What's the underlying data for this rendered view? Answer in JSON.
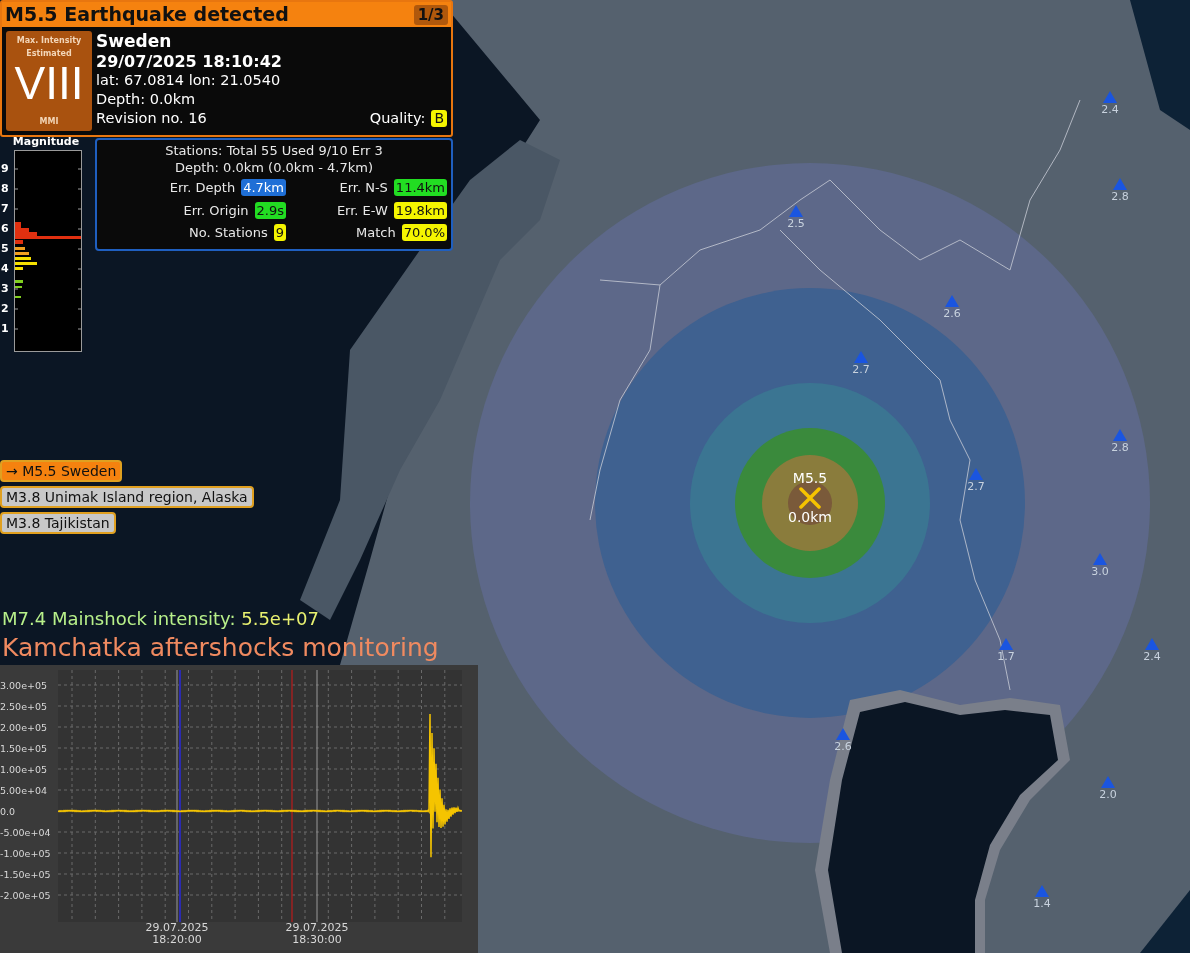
{
  "alert": {
    "title": "M5.5 Earthquake detected",
    "counter": "1/3",
    "intensity": {
      "caption": "Max. Intensity Estimated",
      "value": "VIII",
      "scale": "MMI"
    },
    "region": "Sweden",
    "time": "29/07/2025 18:10:42",
    "coordinates": "lat: 67.0814 lon: 21.0540",
    "depth": "Depth: 0.0km",
    "revision": "Revision no. 16",
    "quality_label": "Quality:",
    "quality": "B"
  },
  "magnitude_chart": {
    "title": "Magnitude",
    "ticks": [
      "9",
      "8",
      "7",
      "6",
      "5",
      "4",
      "3",
      "2",
      "1"
    ]
  },
  "stations_panel": {
    "summary": "Stations: Total 55 Used 9/10 Err 3",
    "depth_range": "Depth: 0.0km (0.0km - 4.7km)",
    "stats": [
      {
        "label": "Err. Depth",
        "value": "4.7km",
        "color": "#1f6fd6"
      },
      {
        "label": "Err. N-S",
        "value": "11.4km",
        "color": "#22dd22"
      },
      {
        "label": "Err. Origin",
        "value": "2.9s",
        "color": "#22dd22"
      },
      {
        "label": "Err. E-W",
        "value": "19.8km",
        "color": "#f5f500"
      },
      {
        "label": "No. Stations",
        "value": "9",
        "color": "#f5f500"
      },
      {
        "label": "Match",
        "value": "70.0%",
        "color": "#f5f500"
      }
    ]
  },
  "events": [
    {
      "label": "→ M5.5 Sweden",
      "selected": true
    },
    {
      "label": "M3.8 Unimak Island region, Alaska",
      "selected": false
    },
    {
      "label": "M3.8 Tajikistan",
      "selected": false
    }
  ],
  "mainshock": {
    "label": "M7.4 Mainshock intensity:",
    "value": "5.5e+07"
  },
  "monitoring_title": "Kamchatka aftershocks monitoring",
  "seismogram": {
    "y_ticks": [
      "3.00e+05",
      "2.50e+05",
      "2.00e+05",
      "1.50e+05",
      "1.00e+05",
      "5.00e+04",
      "0.0",
      "-5.00e+04",
      "-1.00e+05",
      "-1.50e+05",
      "-2.00e+05"
    ],
    "x_ticks": [
      {
        "date": "29.07.2025",
        "time": "18:20:00"
      },
      {
        "date": "29.07.2025",
        "time": "18:30:00"
      }
    ]
  },
  "map": {
    "epicenter": {
      "magnitude": "M5.5",
      "depth": "0.0km"
    },
    "stations": [
      {
        "reading": "2.4"
      },
      {
        "reading": "2.8"
      },
      {
        "reading": "2.5"
      },
      {
        "reading": "2.6"
      },
      {
        "reading": "2.7"
      },
      {
        "reading": "2.8"
      },
      {
        "reading": "2.7"
      },
      {
        "reading": "3.0"
      },
      {
        "reading": "1.7"
      },
      {
        "reading": "2.4"
      },
      {
        "reading": "2.6"
      },
      {
        "reading": "2.0"
      },
      {
        "reading": "1.4"
      }
    ]
  }
}
